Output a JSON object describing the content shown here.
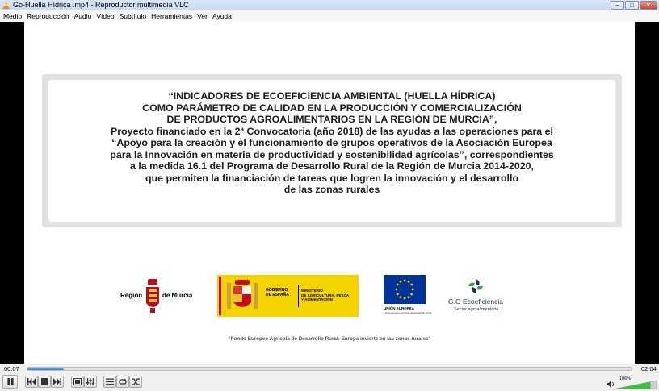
{
  "window": {
    "title": "Go-Huella Hídrica .mp4 - Reproductor multimedia VLC"
  },
  "menu": [
    "Medio",
    "Reproducción",
    "Audio",
    "Vídeo",
    "Subtítulo",
    "Herramientas",
    "Ver",
    "Ayuda"
  ],
  "slide": {
    "lines": [
      "“INDICADORES DE ECOEFICIENCIA AMBIENTAL (HUELLA HÍDRICA)",
      "COMO PARÁMETRO DE CALIDAD EN LA PRODUCCIÓN Y COMERCIALIZACIÓN",
      "DE PRODUCTOS AGROALIMENTARIOS EN LA REGIÓN DE MURCIA”,",
      "Proyecto financiado en la 2ª Convocatoria (año 2018) de las ayudas a las operaciones para el",
      "“Apoyo para la creación y el funcionamiento de grupos operativos de la Asociación Europea",
      "para la Innovación en materia de productividad y sostenibilidad agrícolas”, correspondientes",
      "a la medida 16.1 del Programa de Desarrollo Rural de la Región de Murcia 2014-2020,",
      "que permiten la financiación de tareas que logren la innovación y el desarrollo",
      "de las zonas rurales"
    ],
    "logos": {
      "murcia": {
        "left": "Región",
        "right": "de Murcia"
      },
      "gobierno": {
        "text1": "GOBIERNO\nDE ESPAÑA",
        "text2": "MINISTERIO\nDE AGRICULTURA, PESCA\nY ALIMENTACIÓN"
      },
      "ue": {
        "text1": "UNIÓN EUROPEA",
        "text2": "Fondo Europeo Agrícola de Desarrollo Rural"
      },
      "go": {
        "text1": "G.O Ecoeficiencia",
        "text2": "Sector agroalimentario"
      }
    },
    "footer": "“Fondo Europeo Agrícola de Desarrollo Rural: Europa invierte en las zonas rurales”"
  },
  "player": {
    "time_current": "00:07",
    "time_total": "02:04",
    "progress": 0.06,
    "volume_label": "106%",
    "volume": 1.06
  },
  "colors": {
    "seek_fill": "#2f7dd3",
    "volume_fill": "#3fbf3f",
    "gobierno_yellow": "#f3d400",
    "eu_blue": "#003399"
  }
}
